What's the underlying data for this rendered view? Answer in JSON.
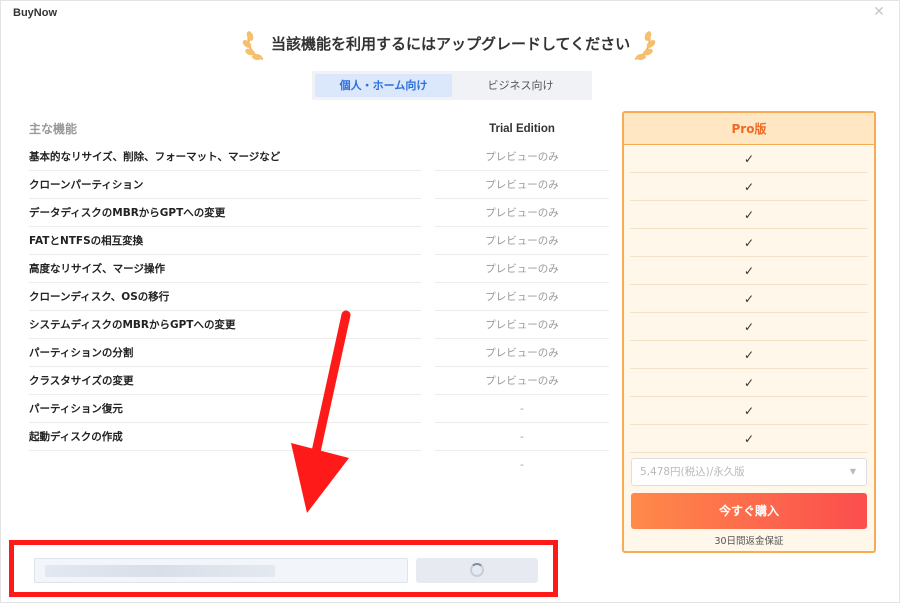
{
  "window": {
    "title": "BuyNow",
    "close_icon": "close-icon"
  },
  "headline": "当該機能を利用するにはアップグレードしてください",
  "tabs": [
    {
      "label": "個人・ホーム向け",
      "active": true
    },
    {
      "label": "ビジネス向け",
      "active": false
    }
  ],
  "features": {
    "header": "主な機能",
    "rows": [
      "基本的なリサイズ、削除、フォーマット、マージなど",
      "クローンパーティション",
      "データディスクのMBRからGPTへの変更",
      "FATとNTFSの相互変換",
      "高度なリサイズ、マージ操作",
      "クローンディスク、OSの移行",
      "システムディスクのMBRからGPTへの変更",
      "パーティションの分割",
      "クラスタサイズの変更",
      "パーティション復元",
      "起動ディスクの作成"
    ]
  },
  "trial": {
    "header": "Trial Edition",
    "cells": [
      "プレビューのみ",
      "プレビューのみ",
      "プレビューのみ",
      "プレビューのみ",
      "プレビューのみ",
      "プレビューのみ",
      "プレビューのみ",
      "プレビューのみ",
      "プレビューのみ",
      "-",
      "-",
      "-"
    ]
  },
  "pro": {
    "header": "Pro版",
    "check_mark": "✓",
    "check_count": 11,
    "plan_select_value": "5,478円(税込)/永久版",
    "buy_label": "今すぐ購入",
    "guarantee": "30日間返金保証"
  },
  "colors": {
    "accent_orange": "#f8ab55",
    "buy_gradient_start": "#ff8a4a",
    "buy_gradient_end": "#fb4d4d",
    "tab_active": "#2f6fdc",
    "annotation_red": "#ff1a1a"
  },
  "icons": {
    "laurel": "laurel-icon",
    "dropdown": "chevron-down-icon",
    "spinner": "loading-spinner-icon",
    "annotation_arrow": "red-arrow-annotation"
  }
}
